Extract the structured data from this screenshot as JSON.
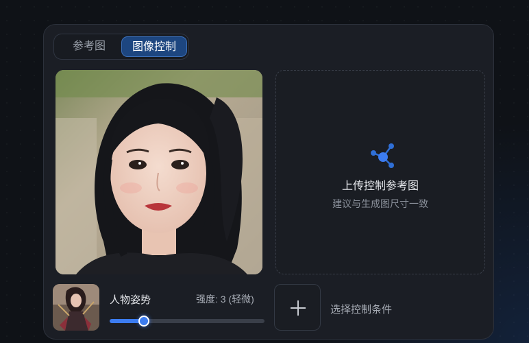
{
  "tabs": [
    {
      "label": "参考图",
      "active": false
    },
    {
      "label": "图像控制",
      "active": true
    }
  ],
  "upload": {
    "icon": "share-nodes-icon",
    "title": "上传控制参考图",
    "subtitle": "建议与生成图尺寸一致"
  },
  "control": {
    "pose_name": "人物姿势",
    "strength_text": "强度: 3 (轻微)",
    "strength_level": 0.22
  },
  "add_control": {
    "icon": "plus-icon",
    "label": "选择控制条件"
  },
  "colors": {
    "accent": "#3c7cf0",
    "panel_bg": "#1b1e25",
    "active_tab": "#1d4680"
  }
}
